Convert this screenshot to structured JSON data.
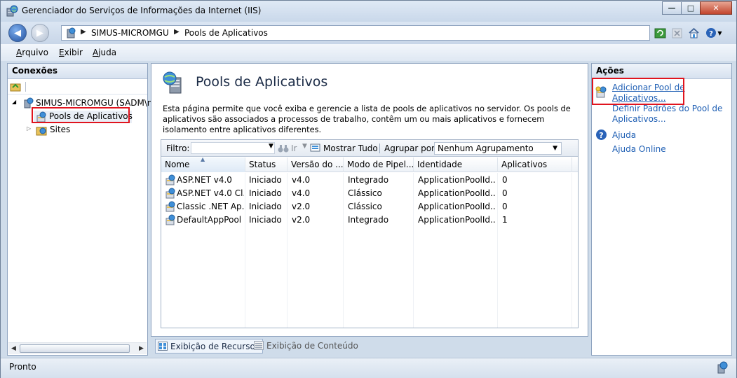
{
  "window": {
    "title": "Gerenciador do Serviços de Informações da Internet (IIS)",
    "controls": [
      "minimize",
      "maximize",
      "close"
    ]
  },
  "navigation": {
    "breadcrumb": [
      "SIMUS-MICROMGU",
      "Pools de Aplicativos"
    ]
  },
  "menu": {
    "items": [
      {
        "label": "Arquivo",
        "accel": "A"
      },
      {
        "label": "Exibir",
        "accel": "E"
      },
      {
        "label": "Ajuda",
        "accel": "A"
      }
    ]
  },
  "connections": {
    "header": "Conexões",
    "tree": {
      "server": "SIMUS-MICROMGU (SADM\\n",
      "children": [
        "Pools de Aplicativos",
        "Sites"
      ]
    }
  },
  "main": {
    "title": "Pools de Aplicativos",
    "description": "Esta página permite que você exiba e gerencie a lista de pools de aplicativos no servidor. Os pools de aplicativos são associados a processos de trabalho, contêm um ou mais aplicativos e fornecem isolamento entre aplicativos diferentes.",
    "filter": {
      "label": "Filtro:",
      "value": "",
      "go_label": "Ir",
      "show_all_label": "Mostrar Tudo",
      "group_by_label": "Agrupar por:",
      "group_by_value": "Nenhum Agrupamento"
    },
    "columns": [
      "Nome",
      "Status",
      "Versão do ...",
      "Modo de Pipel...",
      "Identidade",
      "Aplicativos"
    ],
    "rows": [
      [
        "ASP.NET v4.0",
        "Iniciado",
        "v4.0",
        "Integrado",
        "ApplicationPoolId...",
        "0"
      ],
      [
        "ASP.NET v4.0 Cl...",
        "Iniciado",
        "v4.0",
        "Clássico",
        "ApplicationPoolId...",
        "0"
      ],
      [
        "Classic .NET Ap...",
        "Iniciado",
        "v2.0",
        "Clássico",
        "ApplicationPoolId...",
        "0"
      ],
      [
        "DefaultAppPool",
        "Iniciado",
        "v2.0",
        "Integrado",
        "ApplicationPoolId...",
        "1"
      ]
    ],
    "view_tabs": [
      "Exibição de Recursos",
      "Exibição de Conteúdo"
    ]
  },
  "actions": {
    "header": "Ações",
    "items": [
      {
        "label": "Adicionar Pool de Aplicativos...",
        "icon": "add-pool-icon"
      },
      {
        "label": "Definir Padrões do Pool de Aplicativos...",
        "icon": ""
      },
      {
        "label": "Ajuda",
        "icon": "help-icon"
      },
      {
        "label": "Ajuda Online",
        "icon": ""
      }
    ]
  },
  "status": {
    "text": "Pronto"
  },
  "colors": {
    "link": "#1f5fb4",
    "highlight": "#e0141e",
    "chrome": "#cfdcea"
  }
}
